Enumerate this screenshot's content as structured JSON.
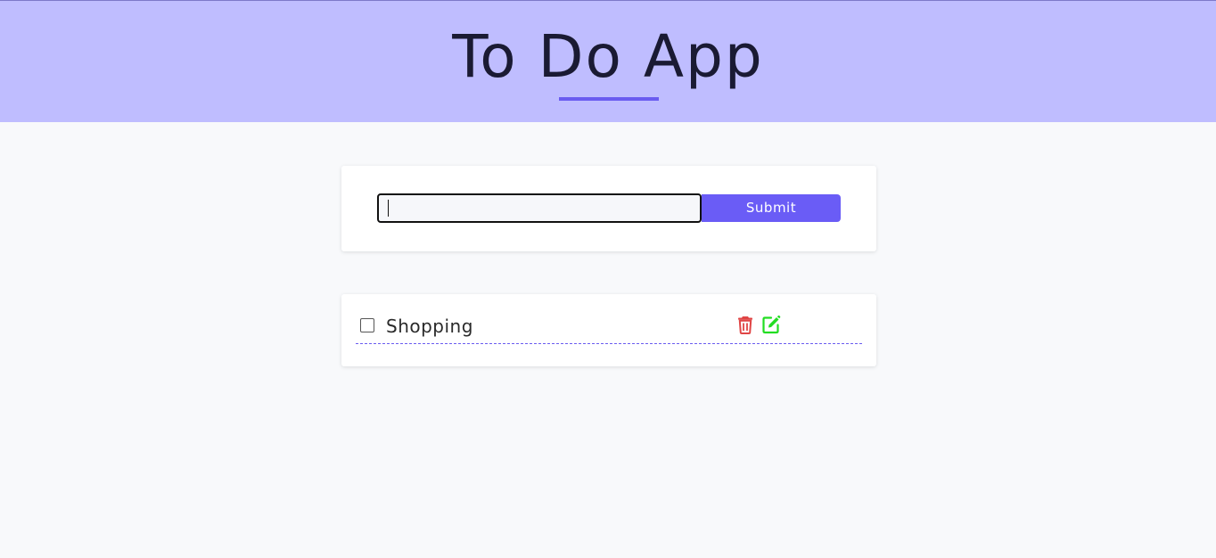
{
  "header": {
    "title": "To Do App",
    "background_color": "#bfbdff",
    "underline_color": "#6a5cf0"
  },
  "form": {
    "input_value": "",
    "input_placeholder": "",
    "submit_label": "Submit",
    "submit_color": "#6a5cf6"
  },
  "todos": [
    {
      "label": "Shopping",
      "checked": false,
      "delete_icon": "trash-icon",
      "delete_color": "#e04545",
      "edit_icon": "edit-icon",
      "edit_color": "#22dd22"
    }
  ]
}
